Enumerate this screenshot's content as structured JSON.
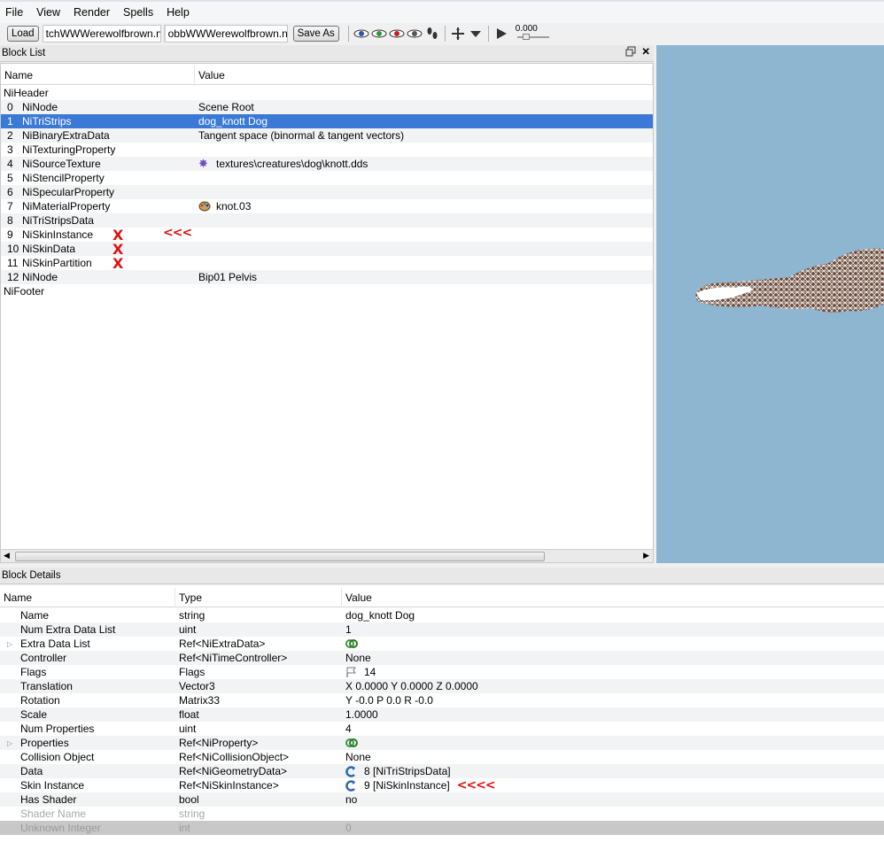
{
  "menu": [
    "File",
    "View",
    "Render",
    "Spells",
    "Help"
  ],
  "toolbar": {
    "load_label": "Load",
    "file1": "tchWWWerewolfbrown.nif",
    "file2": "obbWWWerewolfbrown.nif",
    "saveas_label": "Save As",
    "time_value": "0.000"
  },
  "block_list": {
    "title": "Block List",
    "col_name": "Name",
    "col_value": "Value",
    "header_label": "NiHeader",
    "footer_label": "NiFooter",
    "rows": [
      {
        "num": "0",
        "name": "NiNode",
        "value": "Scene Root"
      },
      {
        "num": "1",
        "name": "NiTriStrips",
        "value": "dog_knott Dog"
      },
      {
        "num": "2",
        "name": "NiBinaryExtraData",
        "value": "Tangent space (binormal & tangent vectors)"
      },
      {
        "num": "3",
        "name": "NiTexturingProperty",
        "value": ""
      },
      {
        "num": "4",
        "name": "NiSourceTexture",
        "value": "textures\\creatures\\dog\\knott.dds"
      },
      {
        "num": "5",
        "name": "NiStencilProperty",
        "value": ""
      },
      {
        "num": "6",
        "name": "NiSpecularProperty",
        "value": ""
      },
      {
        "num": "7",
        "name": "NiMaterialProperty",
        "value": "knot.03"
      },
      {
        "num": "8",
        "name": "NiTriStripsData",
        "value": ""
      },
      {
        "num": "9",
        "name": "NiSkinInstance",
        "value": ""
      },
      {
        "num": "10",
        "name": "NiSkinData",
        "value": ""
      },
      {
        "num": "11",
        "name": "NiSkinPartition",
        "value": ""
      },
      {
        "num": "12",
        "name": "NiNode",
        "value": "Bip01 Pelvis"
      }
    ],
    "annotation_x": "X",
    "annotation_arrow": "<<<"
  },
  "block_details": {
    "title": "Block Details",
    "col_name": "Name",
    "col_type": "Type",
    "col_value": "Value",
    "rows": [
      {
        "name": "Name",
        "type": "string",
        "value": "dog_knott Dog"
      },
      {
        "name": "Num Extra Data List",
        "type": "uint",
        "value": "1"
      },
      {
        "name": "Extra Data List",
        "type": "Ref<NiExtraData>",
        "value": ""
      },
      {
        "name": "Controller",
        "type": "Ref<NiTimeController>",
        "value": "None"
      },
      {
        "name": "Flags",
        "type": "Flags",
        "value": "14"
      },
      {
        "name": "Translation",
        "type": "Vector3",
        "value": "X 0.0000 Y 0.0000 Z 0.0000"
      },
      {
        "name": "Rotation",
        "type": "Matrix33",
        "value": "Y -0.0 P 0.0 R -0.0"
      },
      {
        "name": "Scale",
        "type": "float",
        "value": "1.0000"
      },
      {
        "name": "Num Properties",
        "type": "uint",
        "value": "4"
      },
      {
        "name": "Properties",
        "type": "Ref<NiProperty>",
        "value": ""
      },
      {
        "name": "Collision Object",
        "type": "Ref<NiCollisionObject>",
        "value": "None"
      },
      {
        "name": "Data",
        "type": "Ref<NiGeometryData>",
        "value": "8 [NiTriStripsData]"
      },
      {
        "name": "Skin Instance",
        "type": "Ref<NiSkinInstance>",
        "value": "9 [NiSkinInstance]"
      },
      {
        "name": "Has Shader",
        "type": "bool",
        "value": "no"
      },
      {
        "name": "Shader Name",
        "type": "string",
        "value": ""
      },
      {
        "name": "Unknown Integer",
        "type": "int",
        "value": "0"
      }
    ],
    "annotation_arrow": "<<<<"
  },
  "colors": {
    "viewport": "#8fb6d0",
    "selection": "#3b79d6",
    "annotation": "#dd1111"
  },
  "icons": [
    "view-eye-blue-icon",
    "view-eye-green-icon",
    "view-eye-red-icon",
    "view-eye-grey-icon",
    "footprint-icon",
    "move-icon",
    "dropdown-icon",
    "play-icon",
    "texture-icon",
    "material-icon",
    "link-icon",
    "flag-icon",
    "ref-icon"
  ]
}
